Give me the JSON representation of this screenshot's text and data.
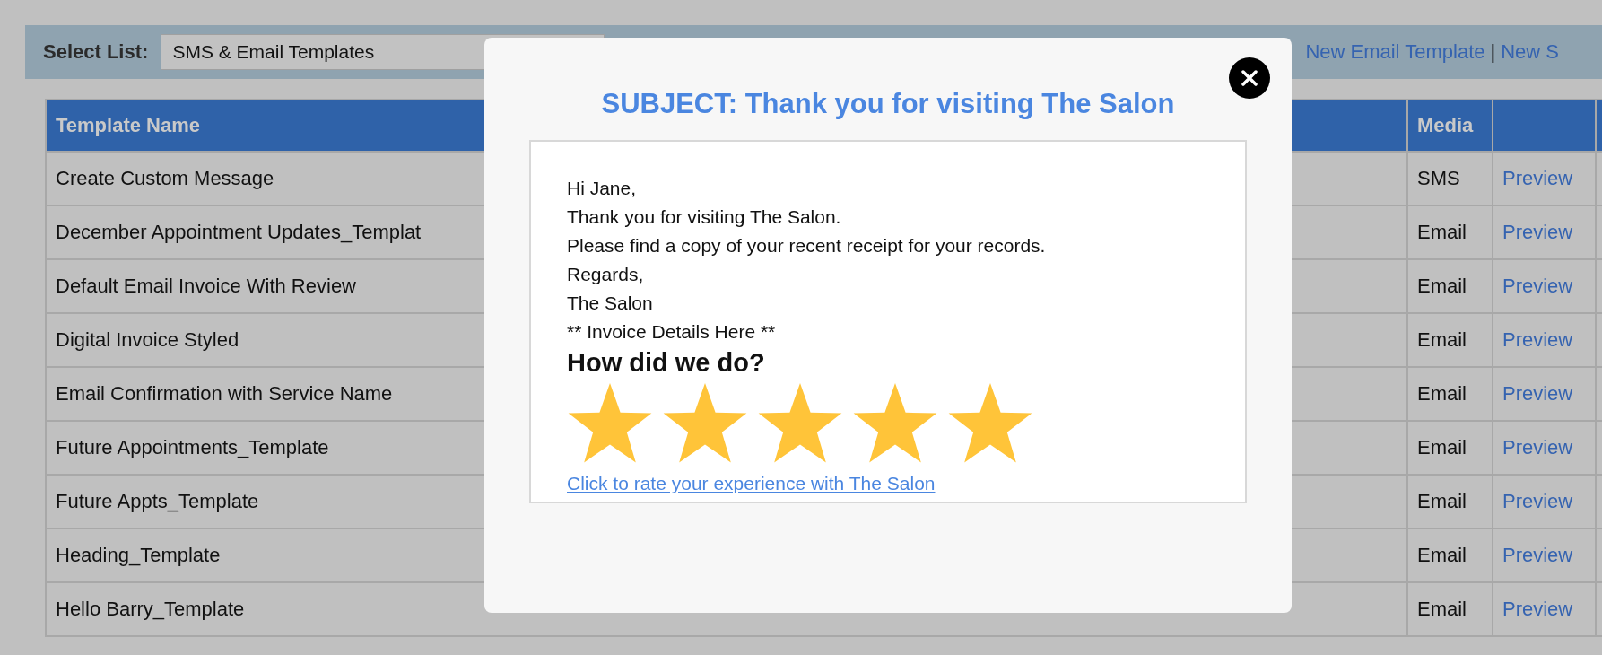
{
  "toolbar": {
    "label": "Select List:",
    "select": {
      "value": "SMS & Email Templates"
    },
    "links": [
      "New Email Template",
      "New S"
    ],
    "separator": "|"
  },
  "table": {
    "columns": [
      "Template Name",
      "Media"
    ],
    "rows": [
      {
        "name": "Create Custom Message",
        "media": "SMS",
        "action": "Preview"
      },
      {
        "name": "December Appointment Updates_Templat",
        "media": "Email",
        "action": "Preview"
      },
      {
        "name": "Default Email Invoice With Review",
        "media": "Email",
        "action": "Preview"
      },
      {
        "name": "Digital Invoice Styled",
        "media": "Email",
        "action": "Preview"
      },
      {
        "name": "Email Confirmation with Service Name",
        "media": "Email",
        "action": "Preview"
      },
      {
        "name": "Future Appointments_Template",
        "media": "Email",
        "action": "Preview"
      },
      {
        "name": "Future Appts_Template",
        "media": "Email",
        "action": "Preview"
      },
      {
        "name": "Heading_Template",
        "media": "Email",
        "action": "Preview"
      },
      {
        "name": "Hello Barry_Template",
        "media": "Email",
        "action": "Preview"
      }
    ]
  },
  "modal": {
    "subject": "SUBJECT: Thank you for visiting The Salon",
    "body_lines": [
      "Hi Jane,",
      "Thank you for visiting The Salon.",
      "Please find a copy of your recent receipt for your records.",
      "Regards,",
      "The Salon",
      "** Invoice Details Here **"
    ],
    "heading": "How did we do?",
    "stars": 5,
    "rating_link": "Click to rate your experience with The Salon"
  }
}
